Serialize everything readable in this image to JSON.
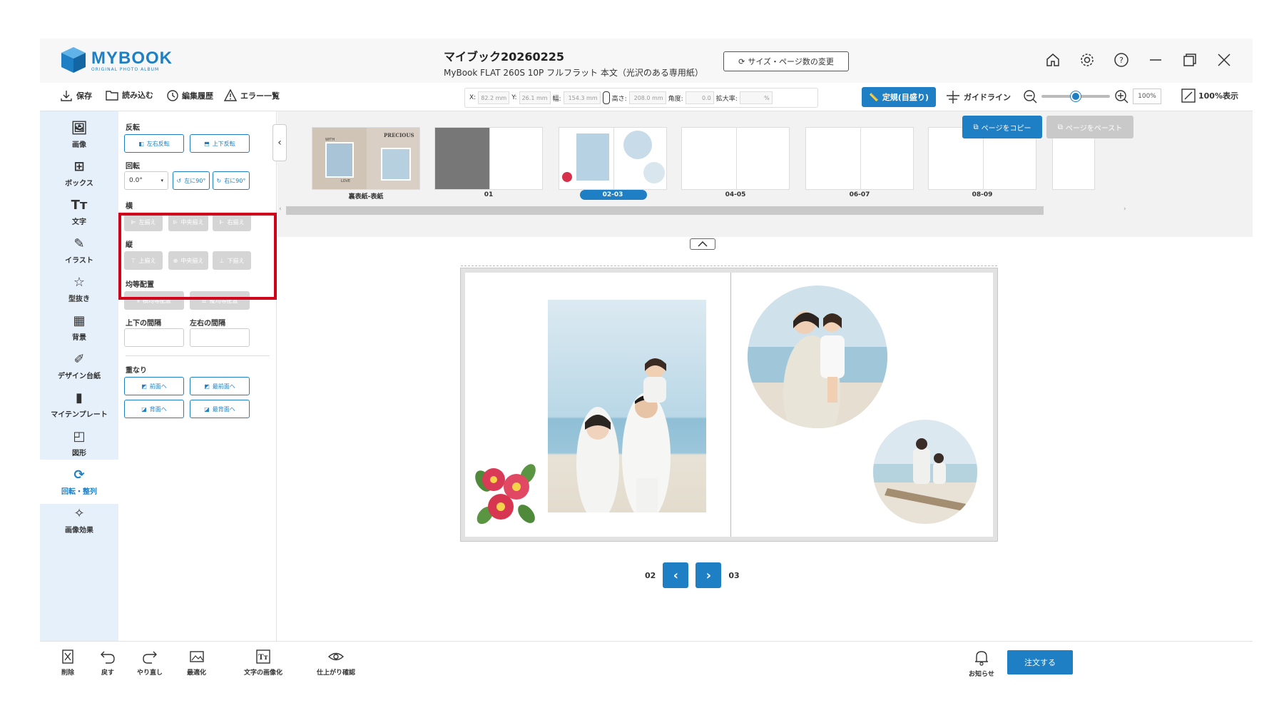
{
  "brand": {
    "name": "MYBOOK",
    "tagline": "ORIGINAL PHOTO ALBUM"
  },
  "document": {
    "title": "マイブック20260225",
    "spec": "MyBook FLAT 260S 10P フルフラット 本文（光沢のある専用紙）"
  },
  "size_change_label": "サイズ・ページ数の変更",
  "toolbar": {
    "save": "保存",
    "import": "読み込む",
    "history": "編集履歴",
    "errors": "エラー一覧",
    "x_label": "X:",
    "x_value": "82.2 mm",
    "y_label": "Y:",
    "y_value": "26.1 mm",
    "width_label": "幅:",
    "width_value": "154.3 mm",
    "height_label": "高さ:",
    "height_value": "208.0 mm",
    "angle_label": "角度:",
    "angle_value": "0.0",
    "scale_label": "拡大率:",
    "scale_value": "%",
    "ruler": "定規(目盛り)",
    "guideline": "ガイドライン",
    "zoom_value": "100%",
    "zoom_level": 0.5,
    "fit": "100%表示"
  },
  "rail": [
    {
      "label": "画像",
      "icon": "image-add-icon"
    },
    {
      "label": "ボックス",
      "icon": "box-layout-icon"
    },
    {
      "label": "文字",
      "icon": "text-icon"
    },
    {
      "label": "イラスト",
      "icon": "brush-icon"
    },
    {
      "label": "型抜き",
      "icon": "star-cut-icon"
    },
    {
      "label": "背景",
      "icon": "checker-icon"
    },
    {
      "label": "デザイン台紙",
      "icon": "design-sheet-icon"
    },
    {
      "label": "マイテンプレート",
      "icon": "template-icon"
    },
    {
      "label": "図形",
      "icon": "shapes-icon"
    },
    {
      "label": "回転・整列",
      "icon": "rotate-icon"
    },
    {
      "label": "画像効果",
      "icon": "magic-wand-icon"
    }
  ],
  "panel": {
    "flip_title": "反転",
    "flip_h": "左右反転",
    "flip_v": "上下反転",
    "rotate_title": "回転",
    "rotate_value": "0.0°",
    "rotate_left": "左に90°",
    "rotate_right": "右に90°",
    "horizontal_title": "横",
    "align_left": "左揃え",
    "align_hcenter": "中央揃え",
    "align_right": "右揃え",
    "vertical_title": "縦",
    "align_top": "上揃え",
    "align_vcenter": "中央揃え",
    "align_bottom": "下揃え",
    "distribute_title": "均等配置",
    "distribute_h": "横均等配置",
    "distribute_v": "縦均等配置",
    "gap_v_title": "上下の間隔",
    "gap_h_title": "左右の間隔",
    "layer_title": "重なり",
    "forward": "前面へ",
    "front": "最前面へ",
    "backward": "背面へ",
    "back": "最背面へ"
  },
  "strip": {
    "copy": "ページをコピー",
    "paste": "ページをペースト",
    "pages": [
      "裏表紙-表紙",
      "01",
      "02-03",
      "04-05",
      "06-07",
      "08-09"
    ],
    "cover_text_1": "PRECIOUS",
    "cover_text_2": "WITH",
    "cover_text_3": "LOVE"
  },
  "pager": {
    "left": "02",
    "right": "03"
  },
  "bottom": {
    "delete": "削除",
    "undo": "戻す",
    "redo": "やり直し",
    "optimize": "最適化",
    "text_to_image": "文字の画像化",
    "preview": "仕上がり確認",
    "notice": "お知らせ",
    "order": "注文する"
  },
  "colors": {
    "accent": "#1e7fc4",
    "rail_bg": "#e6f0fb",
    "highlight": "#d0021b"
  }
}
